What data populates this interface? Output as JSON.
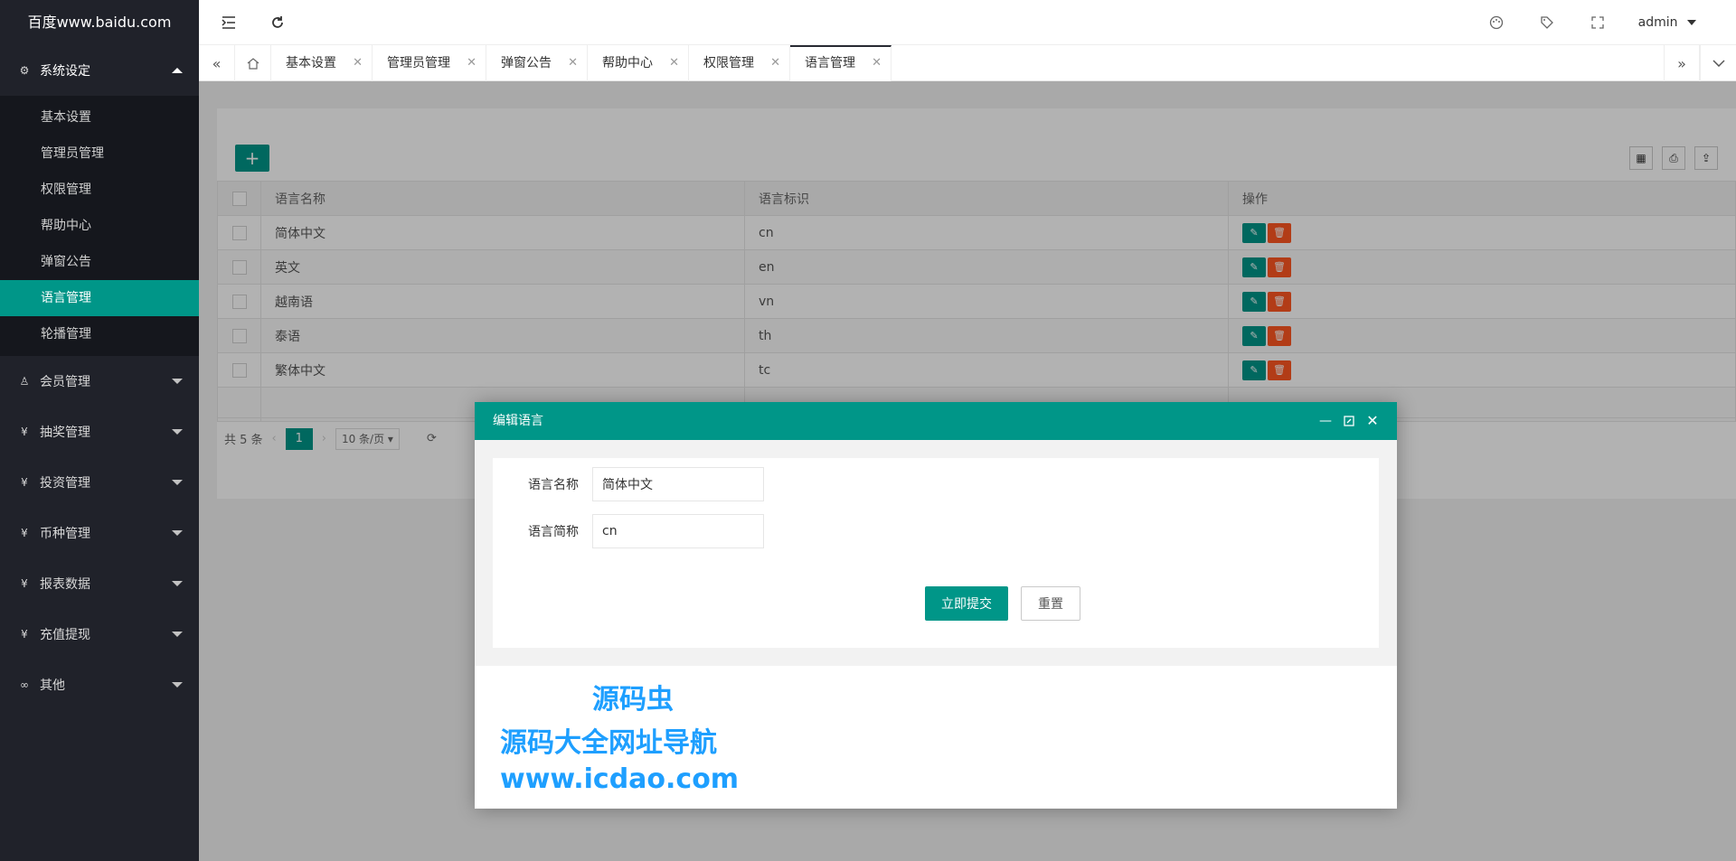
{
  "logo": "百度www.baidu.com",
  "sidebar": {
    "groups": [
      {
        "label": "系统设定",
        "icon": "gear-icon",
        "open": true,
        "items": [
          "基本设置",
          "管理员管理",
          "权限管理",
          "帮助中心",
          "弹窗公告",
          "语言管理",
          "轮播管理"
        ]
      },
      {
        "label": "会员管理",
        "icon": "user-icon"
      },
      {
        "label": "抽奖管理",
        "icon": "yen-icon"
      },
      {
        "label": "投资管理",
        "icon": "yen-icon"
      },
      {
        "label": "币种管理",
        "icon": "yen-icon"
      },
      {
        "label": "报表数据",
        "icon": "yen-icon"
      },
      {
        "label": "充值提现",
        "icon": "yen-icon"
      },
      {
        "label": "其他",
        "icon": "link-icon"
      }
    ],
    "active_item": "语言管理"
  },
  "header": {
    "user": "admin"
  },
  "tabs": [
    "基本设置",
    "管理员管理",
    "弹窗公告",
    "帮助中心",
    "权限管理",
    "语言管理"
  ],
  "active_tab": "语言管理",
  "table": {
    "columns": [
      "语言名称",
      "语言标识",
      "操作"
    ],
    "rows": [
      {
        "name": "简体中文",
        "code": "cn"
      },
      {
        "name": "英文",
        "code": "en"
      },
      {
        "name": "越南语",
        "code": "vn"
      },
      {
        "name": "泰语",
        "code": "th"
      },
      {
        "name": "繁体中文",
        "code": "tc"
      }
    ]
  },
  "pager": {
    "total": "共 5 条",
    "current": "1",
    "per_page": "10 条/页"
  },
  "dialog": {
    "title": "编辑语言",
    "field1_label": "语言名称",
    "field1_value": "简体中文",
    "field2_label": "语言简称",
    "field2_value": "cn",
    "submit": "立即提交",
    "reset": "重置"
  },
  "watermark": {
    "line1": "源码虫",
    "line2": "源码大全网址导航",
    "line3": "www.icdao.com"
  },
  "colors": {
    "primary": "#009688",
    "danger": "#ff5722",
    "sidebar": "#20222a",
    "watermark": "#1e9fff"
  }
}
